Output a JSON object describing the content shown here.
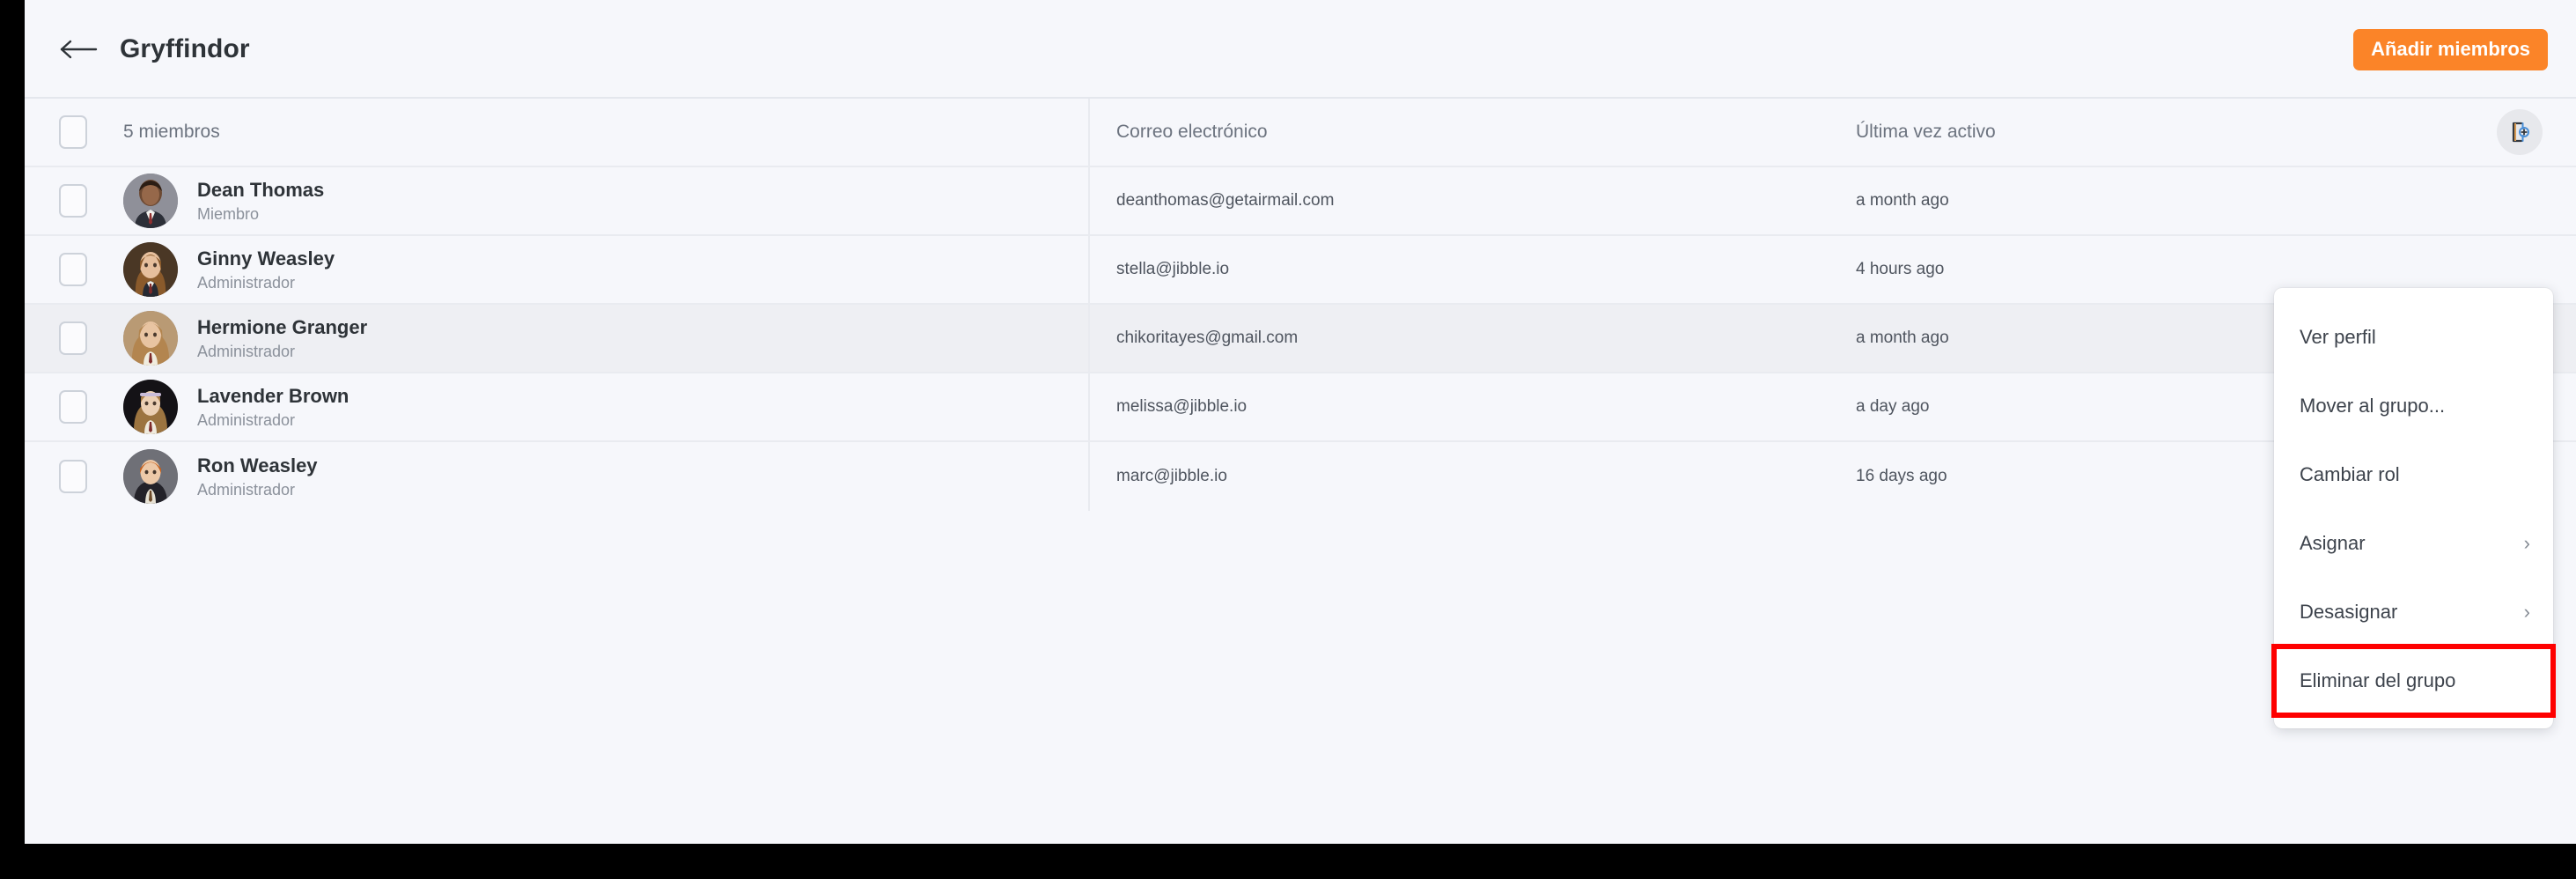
{
  "header": {
    "back_icon": "arrow-left-icon",
    "title": "Gryffindor",
    "add_members_label": "Añadir miembros",
    "accent_color": "#fb8428"
  },
  "table": {
    "columns": {
      "members_count": "5 miembros",
      "email": "Correo electrónico",
      "last_active": "Última vez activo"
    },
    "export_icon": "export-document-icon",
    "rows": [
      {
        "name": "Dean Thomas",
        "role": "Miembro",
        "email": "deanthomas@getairmail.com",
        "last_active": "a month ago",
        "avatar": "avatar-dean-thomas",
        "hovered": false
      },
      {
        "name": "Ginny Weasley",
        "role": "Administrador",
        "email": "stella@jibble.io",
        "last_active": "4 hours ago",
        "avatar": "avatar-ginny-weasley",
        "hovered": false
      },
      {
        "name": "Hermione Granger",
        "role": "Administrador",
        "email": "chikoritayes@gmail.com",
        "last_active": "a month ago",
        "avatar": "avatar-hermione-granger",
        "hovered": true
      },
      {
        "name": "Lavender Brown",
        "role": "Administrador",
        "email": "melissa@jibble.io",
        "last_active": "a day ago",
        "avatar": "avatar-lavender-brown",
        "hovered": false
      },
      {
        "name": "Ron Weasley",
        "role": "Administrador",
        "email": "marc@jibble.io",
        "last_active": "16 days ago",
        "avatar": "avatar-ron-weasley",
        "hovered": false
      }
    ]
  },
  "context_menu": {
    "items": [
      {
        "label": "Ver perfil",
        "submenu": false,
        "highlighted": false
      },
      {
        "label": "Mover al grupo...",
        "submenu": false,
        "highlighted": false
      },
      {
        "label": "Cambiar rol",
        "submenu": false,
        "highlighted": false
      },
      {
        "label": "Asignar",
        "submenu": true,
        "highlighted": false
      },
      {
        "label": "Desasignar",
        "submenu": true,
        "highlighted": false
      },
      {
        "label": "Eliminar del grupo",
        "submenu": false,
        "highlighted": true
      }
    ],
    "chevron_glyph": "›",
    "highlight_color": "#fe0000"
  }
}
